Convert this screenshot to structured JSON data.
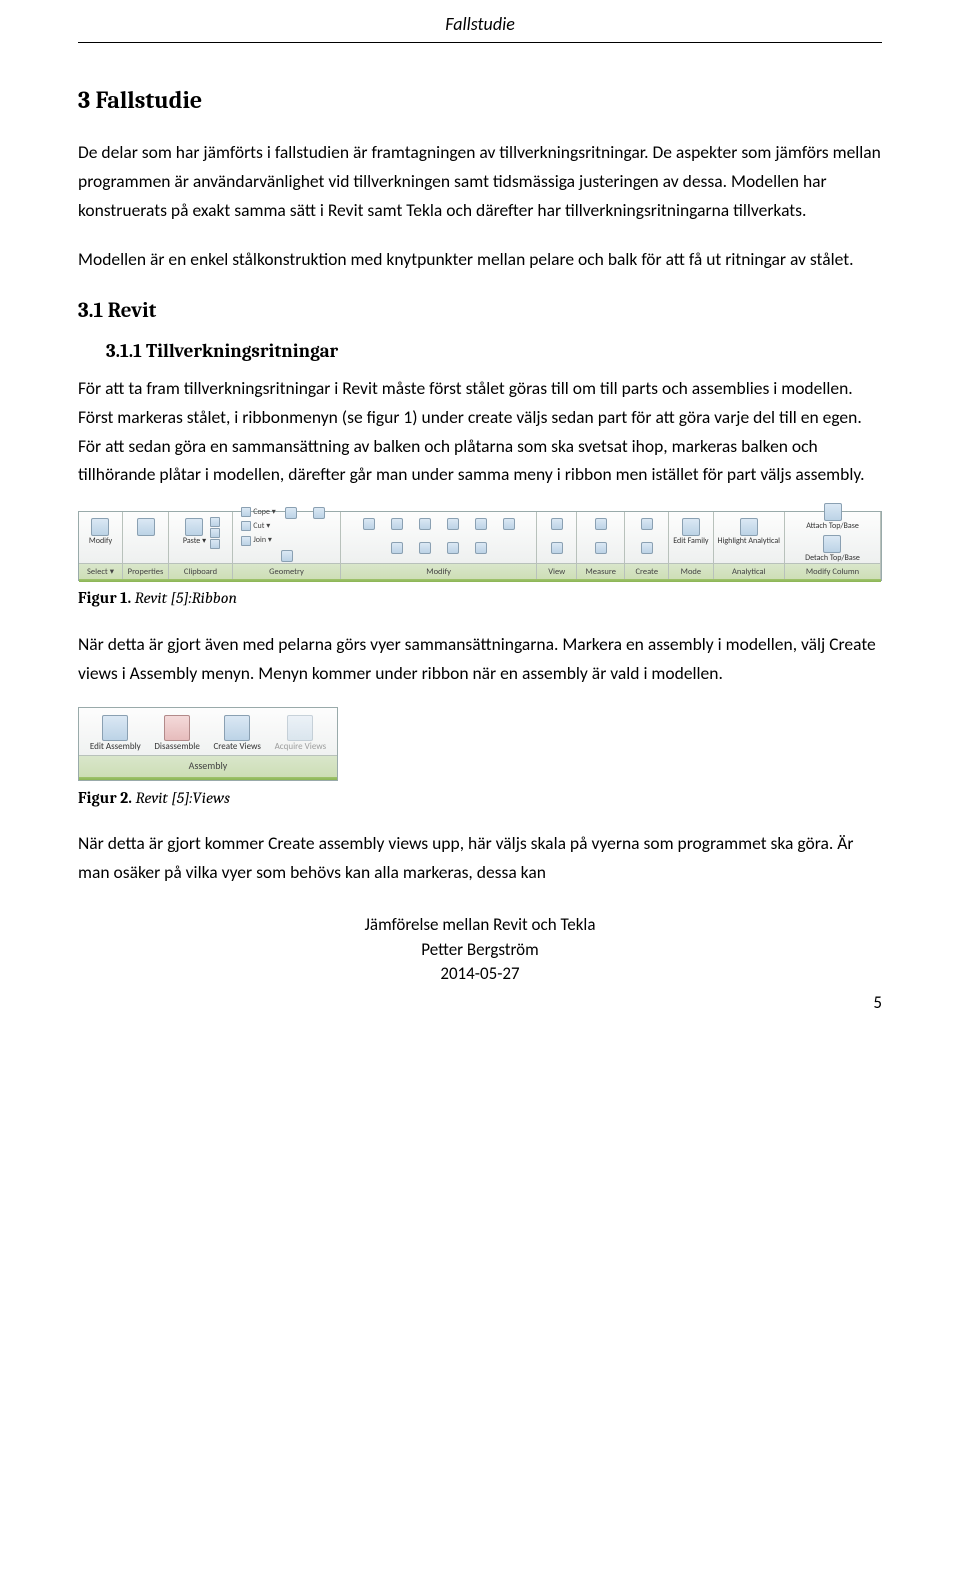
{
  "header": {
    "title": "Fallstudie"
  },
  "h1": "3   Fallstudie",
  "p1": "De delar som har jämförts i fallstudien är framtagningen av tillverkningsritningar. De aspekter som jämförs mellan programmen är användarvänlighet vid tillverkningen samt tidsmässiga justeringen av dessa. Modellen har konstruerats på exakt samma sätt i Revit samt Tekla och därefter har tillverkningsritningarna tillverkats.",
  "p2": "Modellen är en enkel stålkonstruktion med knytpunkter mellan pelare och balk för att få ut ritningar av stålet.",
  "h2": "3.1 Revit",
  "h3": "3.1.1   Tillverkningsritningar",
  "p3": "För att ta fram tillverkningsritningar i Revit måste först stålet göras till om till parts och assemblies i modellen. Först markeras stålet, i ribbonmenyn (se figur 1) under create väljs sedan part för att göra varje del till en egen. För att sedan göra en sammansättning av balken och plåtarna som ska svetsat ihop, markeras balken och tillhörande plåtar i modellen, därefter går man under samma meny i ribbon men istället för part väljs assembly.",
  "figure1": {
    "bold": "Figur 1.",
    "ital": " Revit [5]:Ribbon"
  },
  "p4": "När detta är gjort även med pelarna görs vyer sammansättningarna. Markera en assembly i modellen, välj Create views i Assembly menyn. Menyn kommer under ribbon när en assembly är vald i modellen.",
  "figure2": {
    "bold": "Figur 2.",
    "ital": " Revit [5]:Views"
  },
  "p5": "När detta är gjort kommer Create assembly views upp, här väljs skala på vyerna som programmet ska göra. Är man osäker på vilka vyer som behövs kan alla markeras, dessa kan",
  "ribbon": {
    "groups": [
      {
        "label": "Select ▾",
        "icons": [
          {
            "label": "Modify"
          }
        ]
      },
      {
        "label": "Properties",
        "icons": [
          {
            "label": ""
          }
        ]
      },
      {
        "label": "Clipboard",
        "icons": [
          {
            "label": "Paste ▾"
          }
        ],
        "mini": [
          "",
          "",
          ""
        ]
      },
      {
        "label": "Geometry",
        "mini": [
          "Cope ▾",
          "Cut ▾",
          "Join ▾"
        ],
        "extra": 3
      },
      {
        "label": "Modify",
        "extra": 10
      },
      {
        "label": "View",
        "extra": 2
      },
      {
        "label": "Measure",
        "extra": 2
      },
      {
        "label": "Create",
        "extra": 2
      },
      {
        "label": "Mode",
        "icons": [
          {
            "label": "Edit Family"
          }
        ]
      },
      {
        "label": "Analytical",
        "icons": [
          {
            "label": "Highlight Analytical"
          }
        ]
      },
      {
        "label": "Modify Column",
        "icons": [
          {
            "label": "Attach Top/Base"
          },
          {
            "label": "Detach Top/Base"
          }
        ]
      }
    ]
  },
  "panel2": {
    "label": "Assembly",
    "icons": [
      {
        "label": "Edit Assembly",
        "disabled": false
      },
      {
        "label": "Disassemble",
        "disabled": false
      },
      {
        "label": "Create Views",
        "disabled": false
      },
      {
        "label": "Acquire Views",
        "disabled": true
      }
    ]
  },
  "footer": {
    "line1": "Jämförelse mellan Revit och Tekla",
    "line2": "Petter Bergström",
    "line3": "2014-05-27"
  },
  "page_number": "5"
}
